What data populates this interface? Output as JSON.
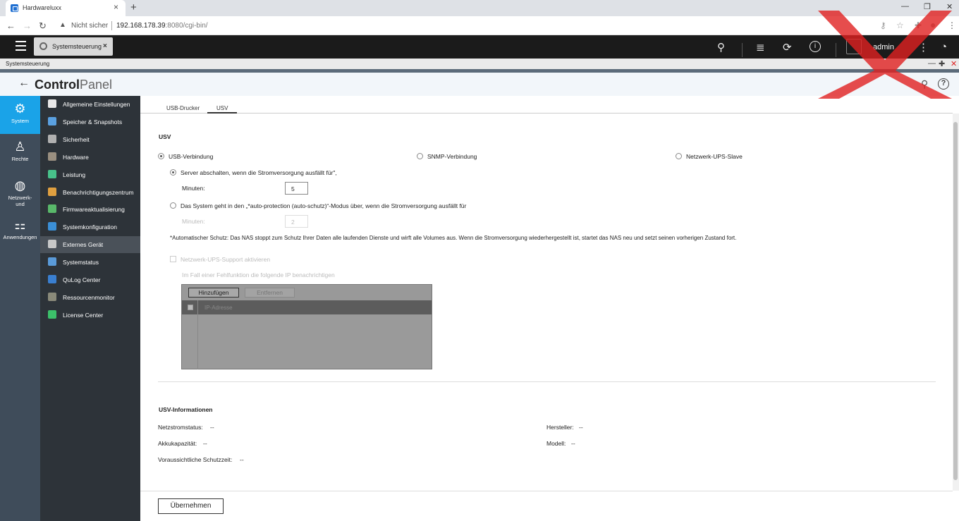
{
  "browser": {
    "tab_title": "Hardwareluxx",
    "security": "Nicht sicher",
    "url_host": "192.168.178.39",
    "url_rest": ":8080/cgi-bin/"
  },
  "qts": {
    "app_tab": "Systemsteuerung",
    "user": "admin"
  },
  "window": {
    "title": "Systemsteuerung"
  },
  "header": {
    "title_bold": "Control",
    "title_light": "Panel"
  },
  "rail": [
    {
      "label": "System",
      "icon": "gear-icon"
    },
    {
      "label": "Rechte",
      "icon": "user-icon"
    },
    {
      "label": "Netzwerk-",
      "label2": "und",
      "icon": "globe-icon"
    },
    {
      "label": "Anwendungen",
      "icon": "apps-icon"
    }
  ],
  "menu": [
    {
      "label": "Allgemeine Einstellungen",
      "color": "#e8e8e8"
    },
    {
      "label": "Speicher & Snapshots",
      "color": "#5aa0e0"
    },
    {
      "label": "Sicherheit",
      "color": "#b0b0b0"
    },
    {
      "label": "Hardware",
      "color": "#9a8f80"
    },
    {
      "label": "Leistung",
      "color": "#48c28a"
    },
    {
      "label": "Benachrichtigungszentrum",
      "color": "#e0a040"
    },
    {
      "label": "Firmwareaktualisierung",
      "color": "#59b86a"
    },
    {
      "label": "Systemkonfiguration",
      "color": "#3b8fd6"
    },
    {
      "label": "Externes Gerät",
      "color": "#c8c8c8"
    },
    {
      "label": "Systemstatus",
      "color": "#5a9ad8"
    },
    {
      "label": "QuLog Center",
      "color": "#3a7fd0"
    },
    {
      "label": "Ressourcenmonitor",
      "color": "#8a8a7a"
    },
    {
      "label": "License Center",
      "color": "#3cc06a"
    }
  ],
  "tabs": [
    "USB-Drucker",
    "USV"
  ],
  "usv": {
    "section_title": "USV",
    "conn_usb": "USB-Verbindung",
    "conn_snmp": "SNMP-Verbindung",
    "conn_slave": "Netzwerk-UPS-Slave",
    "opt_shutdown": "Server abschalten, wenn die Stromversorgung ausfällt für\",",
    "minutes_label": "Minuten:",
    "minutes_value": "5",
    "opt_autoprotect": "Das System geht in den „*auto-protection (auto-schutz)“-Modus über, wenn die Stromversorgung ausfällt für",
    "minutes_label2": "Minuten:",
    "minutes_value2": "2",
    "note": "*Automatischer Schutz: Das NAS stoppt zum Schutz Ihrer Daten alle laufenden Dienste und wirft alle Volumes aus. Wenn die Stromversorgung wiederhergestellt ist, startet das NAS neu und setzt seinen vorherigen Zustand fort.",
    "net_ups_support": "Netzwerk-UPS-Support aktivieren",
    "notify_ip": "Im Fall einer Fehlfunktion die folgende IP benachrichtigen",
    "btn_add": "Hinzufügen",
    "btn_remove": "Entfernen",
    "col_ip": "IP-Adresse"
  },
  "info": {
    "title": "USV-Informationen",
    "power_status_label": "Netzstromstatus:",
    "power_status_value": "--",
    "battery_label": "Akkukapazität:",
    "battery_value": "--",
    "runtime_label": "Voraussichtliche Schutzzeit:",
    "runtime_value": "--",
    "vendor_label": "Hersteller:",
    "vendor_value": "--",
    "model_label": "Modell:",
    "model_value": "--"
  },
  "apply": "Übernehmen"
}
